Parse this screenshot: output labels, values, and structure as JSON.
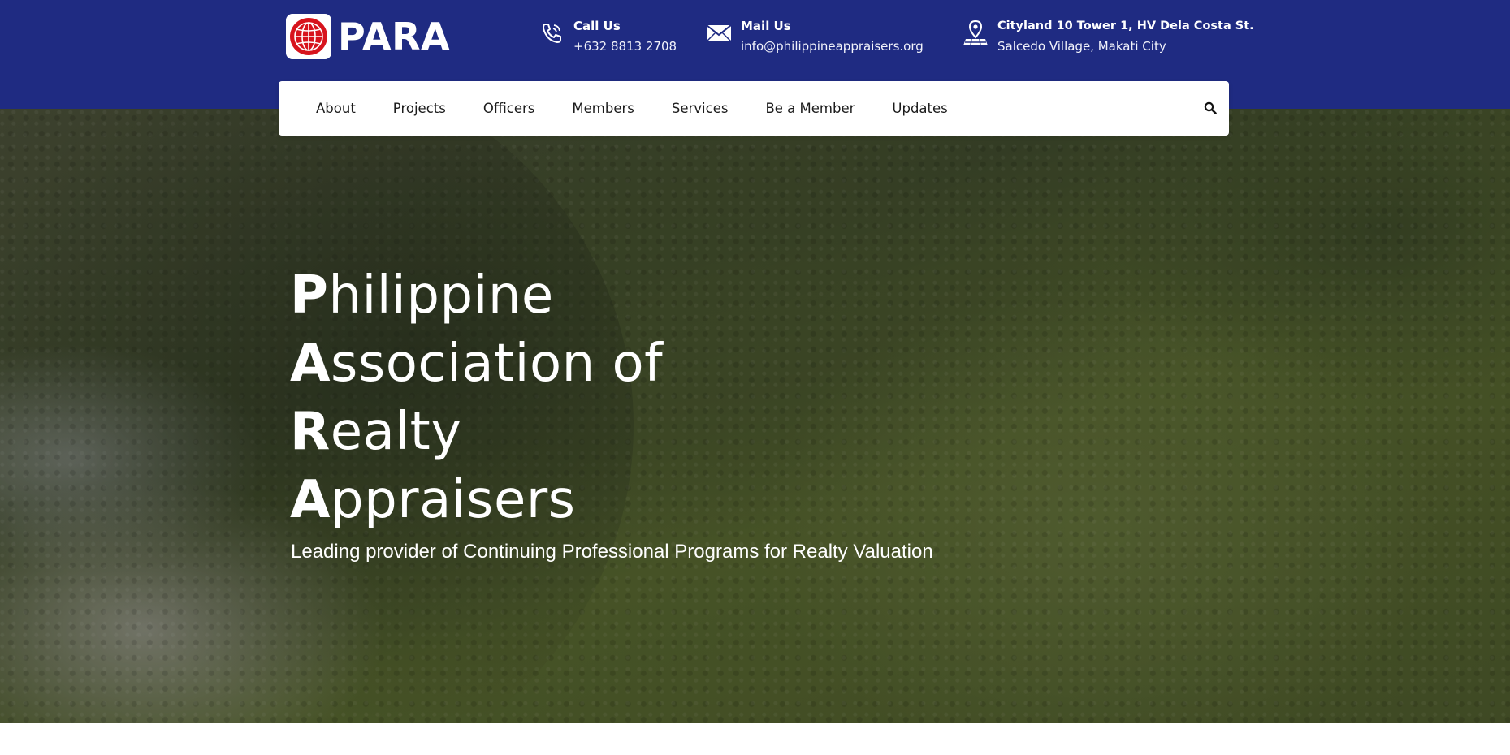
{
  "brand": {
    "name": "PARA",
    "logo_icon": "globe-icon",
    "colors": {
      "header_bg": "#1f2b82",
      "logo_red": "#d7141d"
    }
  },
  "contacts": {
    "call": {
      "title": "Call Us",
      "value": "+632 8813 2708",
      "icon": "phone-icon"
    },
    "mail": {
      "title": "Mail Us",
      "value": "info@philippineappraisers.org",
      "icon": "envelope-icon"
    },
    "address": {
      "title": "Cityland 10 Tower 1, HV Dela Costa St.",
      "value": "Salcedo Village, Makati City",
      "icon": "map-pin-icon"
    }
  },
  "nav": {
    "items": [
      "About",
      "Projects",
      "Officers",
      "Members",
      "Services",
      "Be a Member",
      "Updates"
    ],
    "search_icon": "search-icon"
  },
  "hero": {
    "title_lines": [
      {
        "cap": "P",
        "rest": "hilippine"
      },
      {
        "cap": "A",
        "rest": "ssociation of"
      },
      {
        "cap": "R",
        "rest": "ealty"
      },
      {
        "cap": "A",
        "rest": "ppraisers"
      }
    ],
    "subtitle": "Leading provider of Continuing Professional Programs for Realty Valuation"
  }
}
